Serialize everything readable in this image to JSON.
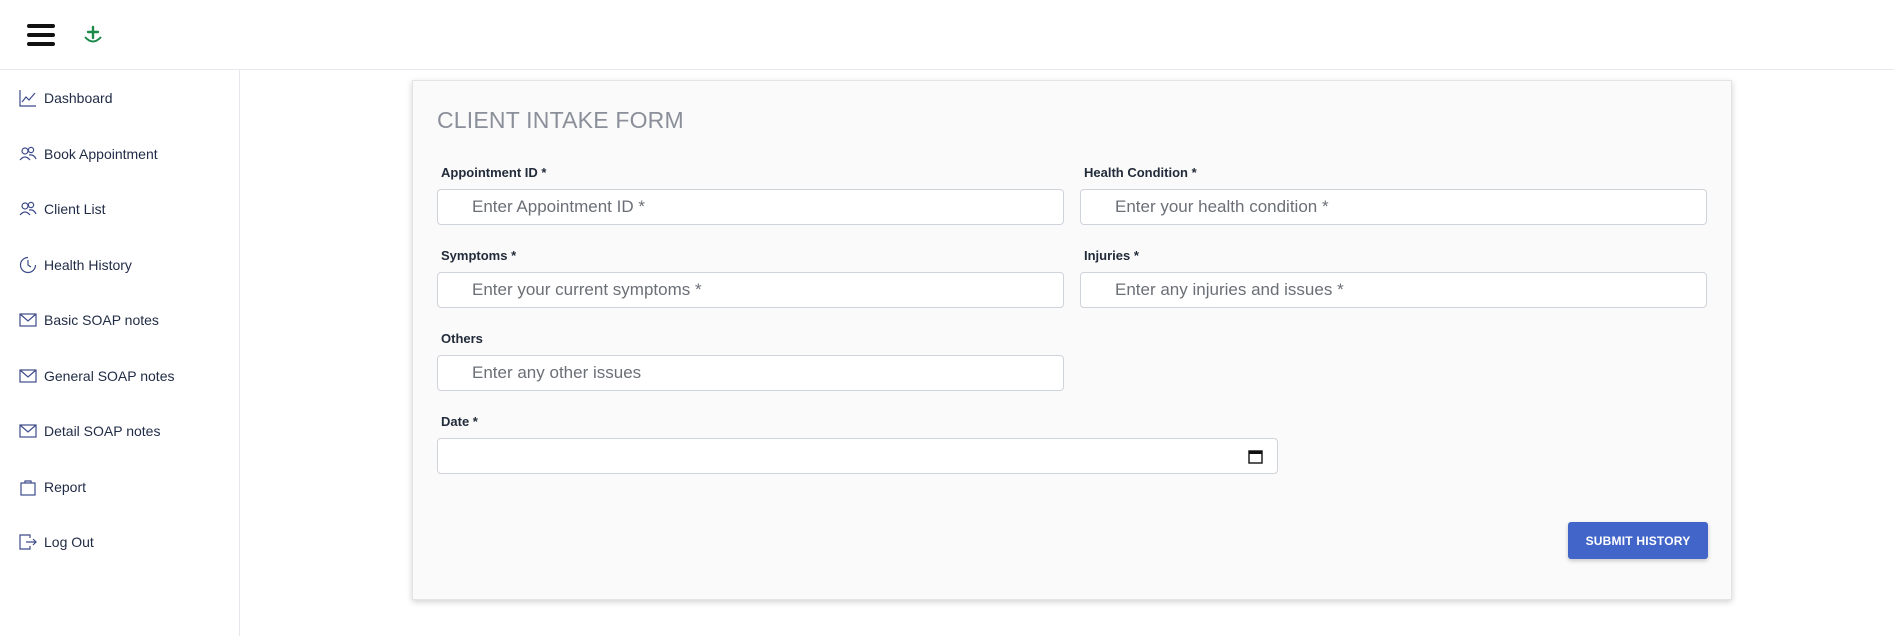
{
  "sidebar": {
    "items": [
      {
        "label": "Dashboard",
        "icon": "chart-line-icon"
      },
      {
        "label": "Book Appointment",
        "icon": "users-icon"
      },
      {
        "label": "Client List",
        "icon": "users-icon"
      },
      {
        "label": "Health History",
        "icon": "clock-icon"
      },
      {
        "label": "Basic SOAP notes",
        "icon": "envelope-icon"
      },
      {
        "label": "General SOAP notes",
        "icon": "envelope-icon"
      },
      {
        "label": "Detail SOAP notes",
        "icon": "envelope-icon"
      },
      {
        "label": "Report",
        "icon": "bag-icon"
      },
      {
        "label": "Log Out",
        "icon": "logout-icon"
      }
    ]
  },
  "form": {
    "title": "CLIENT INTAKE FORM",
    "appointment_id": {
      "label": "Appointment ID *",
      "placeholder": "Enter Appointment ID *",
      "value": ""
    },
    "health_condition": {
      "label": "Health Condition *",
      "placeholder": "Enter your health condition *",
      "value": ""
    },
    "symptoms": {
      "label": "Symptoms *",
      "placeholder": "Enter your current symptoms *",
      "value": ""
    },
    "injuries": {
      "label": "Injuries *",
      "placeholder": "Enter any injuries and issues *",
      "value": ""
    },
    "others": {
      "label": "Others",
      "placeholder": "Enter any other issues",
      "value": ""
    },
    "date": {
      "label": "Date *",
      "value": ""
    },
    "submit_label": "SUBMIT HISTORY"
  },
  "colors": {
    "accent": "#4265c9",
    "icon": "#3d4b8a",
    "logo": "#1d8a4a"
  }
}
